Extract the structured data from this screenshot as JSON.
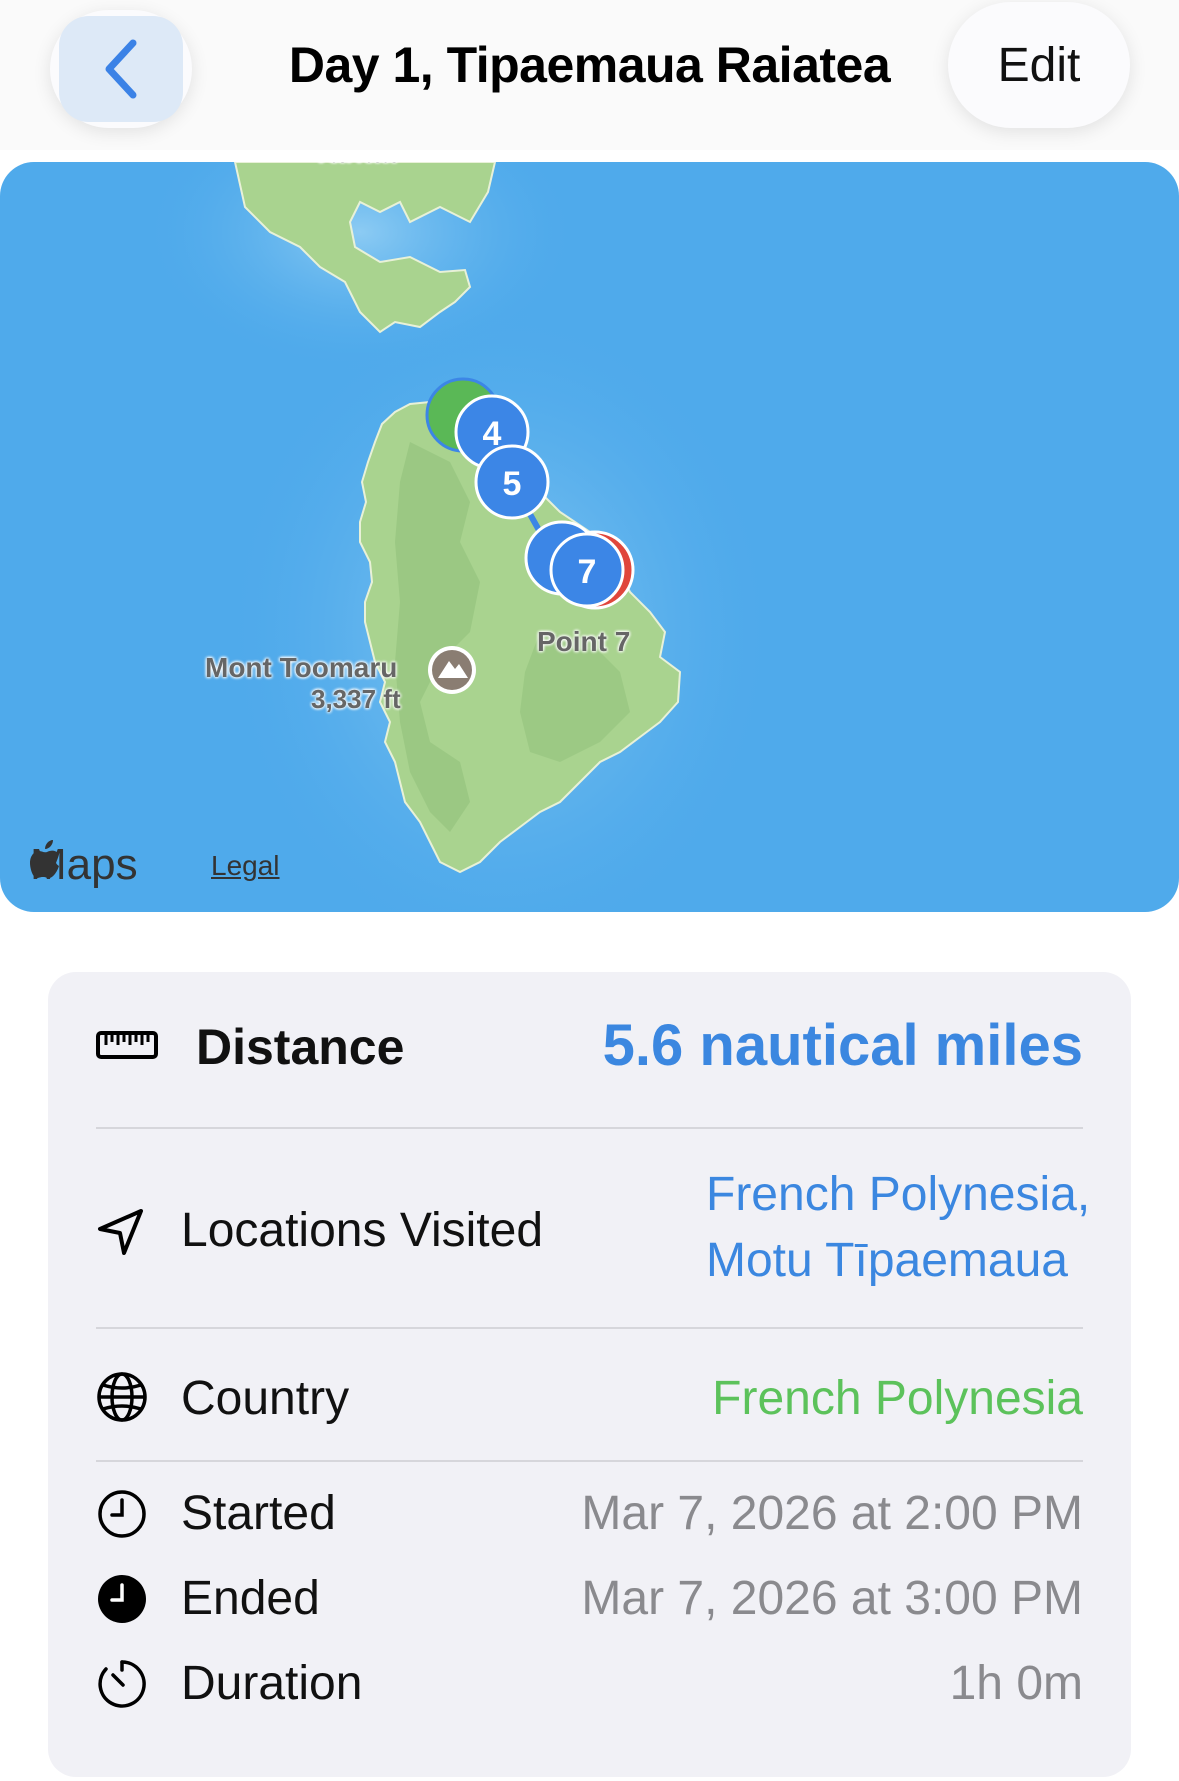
{
  "header": {
    "title": "Day 1, Tipaemaua Raiatea",
    "edit_label": "Edit"
  },
  "map": {
    "top_label": "Tahaa",
    "mountain_name": "Mont Toomaru",
    "mountain_elevation": "3,337 ft",
    "point_label": "Point 7",
    "pins": [
      "4",
      "5",
      "6",
      "7"
    ],
    "brand": "Maps",
    "legal": "Legal",
    "colors": {
      "water": "#4faaeb",
      "land": "#a9d38f",
      "pin_blue": "#3c86e6",
      "pin_green": "#5ab856",
      "pin_red": "#e0463c"
    }
  },
  "details": {
    "distance": {
      "icon": "ruler-icon",
      "label": "Distance",
      "value": "5.6 nautical miles"
    },
    "locations": {
      "icon": "location-arrow-icon",
      "label": "Locations Visited",
      "value_line1": "French Polynesia,",
      "value_line2": "Motu Tīpaemaua"
    },
    "country": {
      "icon": "globe-icon",
      "label": "Country",
      "value": "French Polynesia"
    },
    "started": {
      "icon": "clock-icon",
      "label": "Started",
      "value": "Mar 7, 2026 at 2:00 PM"
    },
    "ended": {
      "icon": "clock-filled-icon",
      "label": "Ended",
      "value": "Mar 7, 2026 at 3:00 PM"
    },
    "duration": {
      "icon": "timer-icon",
      "label": "Duration",
      "value": "1h 0m"
    }
  }
}
